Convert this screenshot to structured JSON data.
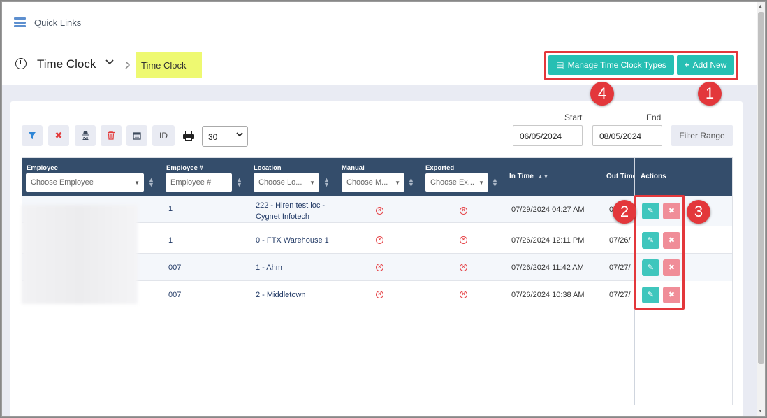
{
  "topbar": {
    "quick_links": "Quick Links"
  },
  "header": {
    "title": "Time Clock",
    "breadcrumb": "Time Clock",
    "manage_types_label": "Manage Time Clock Types",
    "add_new_label": "Add New"
  },
  "callouts": [
    "4",
    "1",
    "2",
    "3"
  ],
  "toolbar": {
    "id_label": "ID",
    "page_size": "30",
    "start_label": "Start",
    "end_label": "End",
    "start_date": "06/05/2024",
    "end_date": "08/05/2024",
    "filter_range_label": "Filter Range"
  },
  "table": {
    "columns": {
      "employee": "Employee",
      "employee_num": "Employee #",
      "location": "Location",
      "manual": "Manual",
      "exported": "Exported",
      "in_time": "In Time",
      "out_time": "Out Time",
      "actions": "Actions"
    },
    "filters": {
      "employee": "Choose Employee",
      "employee_num": "Employee #",
      "location": "Choose Lo...",
      "manual": "Choose M...",
      "exported": "Choose Ex..."
    },
    "rows": [
      {
        "employee_num": "1",
        "location_line1": "222 - Hiren test loc -",
        "location_line2": "Cygnet Infotech",
        "in_time": "07/29/2024 04:27 AM",
        "out_time": "0"
      },
      {
        "employee_num": "1",
        "location_line1": "0 - FTX Warehouse 1",
        "location_line2": "",
        "in_time": "07/26/2024 12:11 PM",
        "out_time": "07/26/"
      },
      {
        "employee_num": "007",
        "location_line1": "1 - Ahm",
        "location_line2": "",
        "in_time": "07/26/2024 11:42 AM",
        "out_time": "07/27/"
      },
      {
        "employee_num": "007",
        "location_line1": "2 - Middletown",
        "location_line2": "",
        "in_time": "07/26/2024 10:38 AM",
        "out_time": "07/27/"
      }
    ]
  },
  "colors": {
    "accent": "#27bfb3",
    "header_bg": "#344d6b",
    "annotation": "#e3373b",
    "highlight": "#eef971"
  }
}
